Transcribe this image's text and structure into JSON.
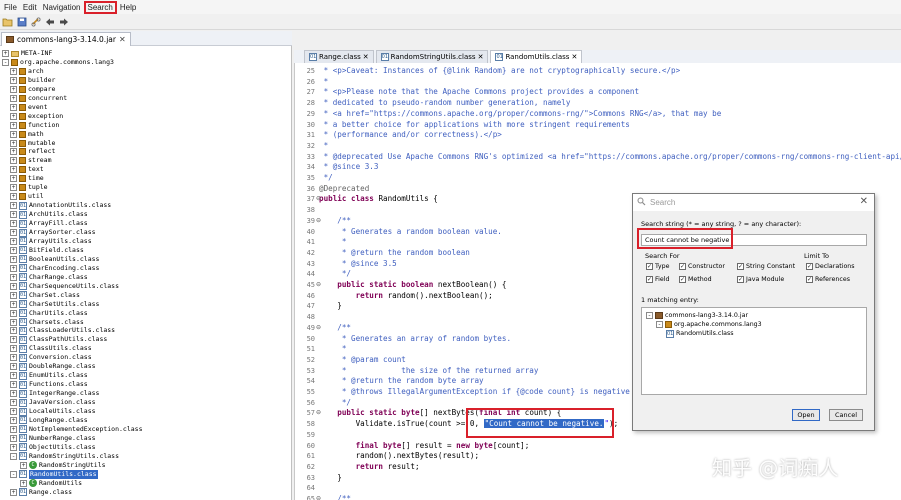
{
  "menu": {
    "items": [
      "File",
      "Edit",
      "Navigation",
      "Search",
      "Help"
    ],
    "active": "Search"
  },
  "left_panel": {
    "tab_label": "commons-lang3-3.14.0.jar",
    "tree": [
      {
        "label": "META-INF",
        "type": "folder",
        "expand": "+"
      },
      {
        "label": "org.apache.commons.lang3",
        "type": "pkg",
        "expand": "-"
      },
      {
        "label": "arch",
        "type": "pkg",
        "expand": "+"
      },
      {
        "label": "builder",
        "type": "pkg",
        "expand": "+"
      },
      {
        "label": "compare",
        "type": "pkg",
        "expand": "+"
      },
      {
        "label": "concurrent",
        "type": "pkg",
        "expand": "+"
      },
      {
        "label": "event",
        "type": "pkg",
        "expand": "+"
      },
      {
        "label": "exception",
        "type": "pkg",
        "expand": "+"
      },
      {
        "label": "function",
        "type": "pkg",
        "expand": "+"
      },
      {
        "label": "math",
        "type": "pkg",
        "expand": "+"
      },
      {
        "label": "mutable",
        "type": "pkg",
        "expand": "+"
      },
      {
        "label": "reflect",
        "type": "pkg",
        "expand": "+"
      },
      {
        "label": "stream",
        "type": "pkg",
        "expand": "+"
      },
      {
        "label": "text",
        "type": "pkg",
        "expand": "+"
      },
      {
        "label": "time",
        "type": "pkg",
        "expand": "+"
      },
      {
        "label": "tuple",
        "type": "pkg",
        "expand": "+"
      },
      {
        "label": "util",
        "type": "pkg",
        "expand": "+"
      },
      {
        "label": "AnnotationUtils.class",
        "type": "class",
        "expand": "+"
      },
      {
        "label": "ArchUtils.class",
        "type": "class",
        "expand": "+"
      },
      {
        "label": "ArrayFill.class",
        "type": "class",
        "expand": "+"
      },
      {
        "label": "ArraySorter.class",
        "type": "class",
        "expand": "+"
      },
      {
        "label": "ArrayUtils.class",
        "type": "class",
        "expand": "+"
      },
      {
        "label": "BitField.class",
        "type": "class",
        "expand": "+"
      },
      {
        "label": "BooleanUtils.class",
        "type": "class",
        "expand": "+"
      },
      {
        "label": "CharEncoding.class",
        "type": "class",
        "expand": "+"
      },
      {
        "label": "CharRange.class",
        "type": "class",
        "expand": "+"
      },
      {
        "label": "CharSequenceUtils.class",
        "type": "class",
        "expand": "+"
      },
      {
        "label": "CharSet.class",
        "type": "class",
        "expand": "+"
      },
      {
        "label": "CharSetUtils.class",
        "type": "class",
        "expand": "+"
      },
      {
        "label": "CharUtils.class",
        "type": "class",
        "expand": "+"
      },
      {
        "label": "Charsets.class",
        "type": "class",
        "expand": "+"
      },
      {
        "label": "ClassLoaderUtils.class",
        "type": "class",
        "expand": "+"
      },
      {
        "label": "ClassPathUtils.class",
        "type": "class",
        "expand": "+"
      },
      {
        "label": "ClassUtils.class",
        "type": "class",
        "expand": "+"
      },
      {
        "label": "Conversion.class",
        "type": "class",
        "expand": "+"
      },
      {
        "label": "DoubleRange.class",
        "type": "class",
        "expand": "+"
      },
      {
        "label": "EnumUtils.class",
        "type": "class",
        "expand": "+"
      },
      {
        "label": "Functions.class",
        "type": "class",
        "expand": "+"
      },
      {
        "label": "IntegerRange.class",
        "type": "class",
        "expand": "+"
      },
      {
        "label": "JavaVersion.class",
        "type": "class",
        "expand": "+"
      },
      {
        "label": "LocaleUtils.class",
        "type": "class",
        "expand": "+"
      },
      {
        "label": "LongRange.class",
        "type": "class",
        "expand": "+"
      },
      {
        "label": "NotImplementedException.class",
        "type": "class",
        "expand": "+"
      },
      {
        "label": "NumberRange.class",
        "type": "class",
        "expand": "+"
      },
      {
        "label": "ObjectUtils.class",
        "type": "class",
        "expand": "+"
      },
      {
        "label": "RandomStringUtils.class",
        "type": "class",
        "expand": "-"
      },
      {
        "label": "RandomStringUtils",
        "type": "c",
        "expand": "+",
        "indent": 1
      },
      {
        "label": "RandomUtils.class",
        "type": "class",
        "expand": "-",
        "selected": true
      },
      {
        "label": "RandomUtils",
        "type": "c",
        "expand": "+",
        "indent": 1
      },
      {
        "label": "Range.class",
        "type": "class",
        "expand": "+"
      }
    ]
  },
  "editor": {
    "tabs": [
      {
        "label": "Range.class"
      },
      {
        "label": "RandomStringUtils.class"
      },
      {
        "label": "RandomUtils.class",
        "active": true
      }
    ],
    "lines": [
      {
        "n": "25",
        "f": "",
        "tokens": [
          {
            "c": "jd",
            "t": " * <p>Caveat: Instances of {@link Random} are not cryptographically secure.</p>"
          }
        ]
      },
      {
        "n": "26",
        "f": "",
        "tokens": [
          {
            "c": "jd",
            "t": " *"
          }
        ]
      },
      {
        "n": "27",
        "f": "",
        "tokens": [
          {
            "c": "jd",
            "t": " * <p>Please note that the Apache Commons project provides a component"
          }
        ]
      },
      {
        "n": "28",
        "f": "",
        "tokens": [
          {
            "c": "jd",
            "t": " * dedicated to pseudo-random number generation, namely"
          }
        ]
      },
      {
        "n": "29",
        "f": "",
        "tokens": [
          {
            "c": "jd",
            "t": " * <a href=\"https://commons.apache.org/proper/commons-rng/\">Commons RNG</a>, that may be"
          }
        ]
      },
      {
        "n": "30",
        "f": "",
        "tokens": [
          {
            "c": "jd",
            "t": " * a better choice for applications with more stringent requirements"
          }
        ]
      },
      {
        "n": "31",
        "f": "",
        "tokens": [
          {
            "c": "jd",
            "t": " * (performance and/or correctness).</p>"
          }
        ]
      },
      {
        "n": "32",
        "f": "",
        "tokens": [
          {
            "c": "jd",
            "t": " *"
          }
        ]
      },
      {
        "n": "33",
        "f": "",
        "tokens": [
          {
            "c": "jd",
            "t": " * @deprecated Use Apache Commons RNG's optimized <a href=\"https://commons.apache.org/proper/commons-rng/commons-rng-client-api/ap"
          }
        ]
      },
      {
        "n": "34",
        "f": "",
        "tokens": [
          {
            "c": "jd",
            "t": " * @since 3.3"
          }
        ]
      },
      {
        "n": "35",
        "f": "",
        "tokens": [
          {
            "c": "jd",
            "t": " */"
          }
        ]
      },
      {
        "n": "36",
        "f": "",
        "tokens": [
          {
            "c": "ann",
            "t": "@Deprecated"
          }
        ]
      },
      {
        "n": "37",
        "f": "⊖",
        "tokens": [
          {
            "c": "kw",
            "t": "public class "
          },
          {
            "c": "pl",
            "t": "RandomUtils {"
          }
        ]
      },
      {
        "n": "38",
        "f": "",
        "tokens": [
          {
            "c": "pl",
            "t": ""
          }
        ]
      },
      {
        "n": "39",
        "f": "⊖",
        "tokens": [
          {
            "c": "jd",
            "t": "    /**"
          }
        ]
      },
      {
        "n": "40",
        "f": "",
        "tokens": [
          {
            "c": "jd",
            "t": "     * Generates a random boolean value."
          }
        ]
      },
      {
        "n": "41",
        "f": "",
        "tokens": [
          {
            "c": "jd",
            "t": "     *"
          }
        ]
      },
      {
        "n": "42",
        "f": "",
        "tokens": [
          {
            "c": "jd",
            "t": "     * @return the random boolean"
          }
        ]
      },
      {
        "n": "43",
        "f": "",
        "tokens": [
          {
            "c": "jd",
            "t": "     * @since 3.5"
          }
        ]
      },
      {
        "n": "44",
        "f": "",
        "tokens": [
          {
            "c": "jd",
            "t": "     */"
          }
        ]
      },
      {
        "n": "45",
        "f": "⊖",
        "tokens": [
          {
            "c": "kw",
            "t": "    public static boolean "
          },
          {
            "c": "pl",
            "t": "nextBoolean() {"
          }
        ]
      },
      {
        "n": "46",
        "f": "",
        "tokens": [
          {
            "c": "kw",
            "t": "        return "
          },
          {
            "c": "pl",
            "t": "random().nextBoolean();"
          }
        ]
      },
      {
        "n": "47",
        "f": "",
        "tokens": [
          {
            "c": "pl",
            "t": "    }"
          }
        ]
      },
      {
        "n": "48",
        "f": "",
        "tokens": [
          {
            "c": "pl",
            "t": ""
          }
        ]
      },
      {
        "n": "49",
        "f": "⊖",
        "tokens": [
          {
            "c": "jd",
            "t": "    /**"
          }
        ]
      },
      {
        "n": "50",
        "f": "",
        "tokens": [
          {
            "c": "jd",
            "t": "     * Generates an array of random bytes."
          }
        ]
      },
      {
        "n": "51",
        "f": "",
        "tokens": [
          {
            "c": "jd",
            "t": "     *"
          }
        ]
      },
      {
        "n": "52",
        "f": "",
        "tokens": [
          {
            "c": "jd",
            "t": "     * @param count"
          }
        ]
      },
      {
        "n": "53",
        "f": "",
        "tokens": [
          {
            "c": "jd",
            "t": "     *            the size of the returned array"
          }
        ]
      },
      {
        "n": "54",
        "f": "",
        "tokens": [
          {
            "c": "jd",
            "t": "     * @return the random byte array"
          }
        ]
      },
      {
        "n": "55",
        "f": "",
        "tokens": [
          {
            "c": "jd",
            "t": "     * @throws IllegalArgumentException if {@code count} is negative"
          }
        ]
      },
      {
        "n": "56",
        "f": "",
        "tokens": [
          {
            "c": "jd",
            "t": "     */"
          }
        ]
      },
      {
        "n": "57",
        "f": "⊖",
        "tokens": [
          {
            "c": "kw",
            "t": "    public static "
          },
          {
            "c": "kw",
            "t": "byte"
          },
          {
            "c": "pl",
            "t": "[] nextBytes("
          },
          {
            "c": "kw",
            "t": "final int "
          },
          {
            "c": "pl",
            "t": "count) {"
          }
        ]
      },
      {
        "n": "58",
        "f": "",
        "tokens": [
          {
            "c": "pl",
            "t": "        Validate.isTrue(count >= 0, "
          },
          {
            "c": "hl",
            "t": "\"Count cannot be negative."
          },
          {
            "c": "str",
            "t": "\""
          },
          {
            "c": "pl",
            "t": ");"
          }
        ]
      },
      {
        "n": "59",
        "f": "",
        "tokens": [
          {
            "c": "pl",
            "t": ""
          }
        ]
      },
      {
        "n": "60",
        "f": "",
        "tokens": [
          {
            "c": "kw",
            "t": "        final byte"
          },
          {
            "c": "pl",
            "t": "[] result = "
          },
          {
            "c": "kw",
            "t": "new byte"
          },
          {
            "c": "pl",
            "t": "[count];"
          }
        ]
      },
      {
        "n": "61",
        "f": "",
        "tokens": [
          {
            "c": "pl",
            "t": "        random().nextBytes(result);"
          }
        ]
      },
      {
        "n": "62",
        "f": "",
        "tokens": [
          {
            "c": "kw",
            "t": "        return "
          },
          {
            "c": "pl",
            "t": "result;"
          }
        ]
      },
      {
        "n": "63",
        "f": "",
        "tokens": [
          {
            "c": "pl",
            "t": "    }"
          }
        ]
      },
      {
        "n": "64",
        "f": "",
        "tokens": [
          {
            "c": "pl",
            "t": ""
          }
        ]
      },
      {
        "n": "65",
        "f": "⊖",
        "tokens": [
          {
            "c": "jd",
            "t": "    /**"
          }
        ]
      }
    ]
  },
  "search_dialog": {
    "title": "Search",
    "prompt": "Search string (* = any string, ? = any character):",
    "query": "Count cannot be negative",
    "search_for_label": "Search For",
    "search_for": [
      {
        "label": "Type",
        "checked": true
      },
      {
        "label": "Constructor",
        "checked": true
      },
      {
        "label": "String Constant",
        "checked": true
      },
      {
        "label": "Field",
        "checked": true
      },
      {
        "label": "Method",
        "checked": true
      },
      {
        "label": "Java Module",
        "checked": true
      }
    ],
    "limit_to_label": "Limit To",
    "limit_to": [
      {
        "label": "Declarations",
        "checked": true
      },
      {
        "label": "References",
        "checked": true
      }
    ],
    "matching_label": "1 matching entry:",
    "results": [
      {
        "label": "commons-lang3-3.14.0.jar",
        "expand": "-",
        "level": 0
      },
      {
        "label": "org.apache.commons.lang3",
        "expand": "-",
        "level": 1
      },
      {
        "label": "RandomUtils.class",
        "expand": "",
        "level": 2
      }
    ],
    "open_label": "Open",
    "cancel_label": "Cancel"
  },
  "watermark": "知乎 @词痴人"
}
